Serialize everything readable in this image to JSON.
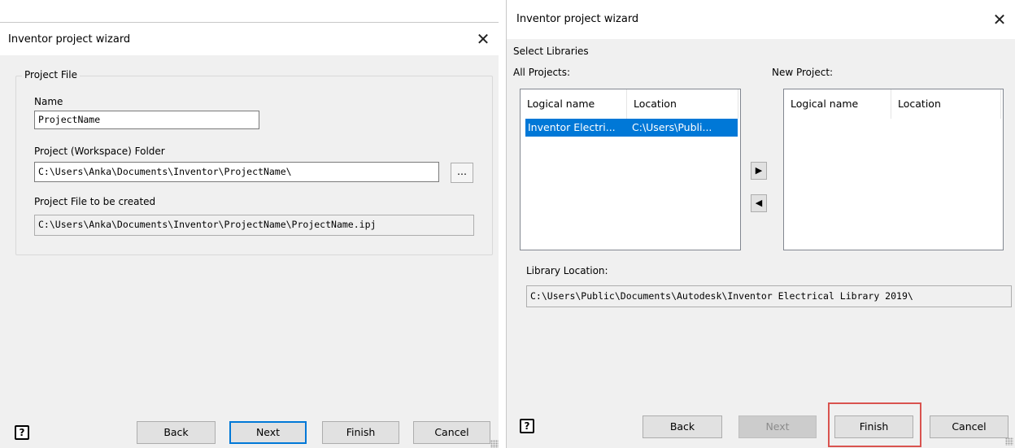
{
  "dialog1": {
    "title": "Inventor project wizard",
    "close_glyph": "✕",
    "group_label": "Project File",
    "name_label": "Name",
    "name_value": "ProjectName",
    "folder_label": "Project (Workspace) Folder",
    "folder_value": "C:\\Users\\Anka\\Documents\\Inventor\\ProjectName\\",
    "browse_label": "...",
    "file_label": "Project File to be created",
    "file_value": "C:\\Users\\Anka\\Documents\\Inventor\\ProjectName\\ProjectName.ipj",
    "help_glyph": "?",
    "buttons": {
      "back": "Back",
      "next": "Next",
      "finish": "Finish",
      "cancel": "Cancel"
    }
  },
  "dialog2": {
    "title": "Inventor project wizard",
    "close_glyph": "✕",
    "section_label": "Select Libraries",
    "all_projects_label": "All Projects:",
    "new_project_label": "New Project:",
    "columns": [
      "Logical name",
      "Location"
    ],
    "all_projects_rows": [
      {
        "name": "Inventor Electri...",
        "location": "C:\\Users\\Publi...",
        "selected": true
      }
    ],
    "move_right_glyph": "▶",
    "move_left_glyph": "◀",
    "library_location_label": "Library Location:",
    "library_location_value": "C:\\Users\\Public\\Documents\\Autodesk\\Inventor Electrical Library 2019\\",
    "help_glyph": "?",
    "buttons": {
      "back": "Back",
      "next": "Next",
      "finish": "Finish",
      "cancel": "Cancel"
    },
    "highlight_color": "#d9534f"
  }
}
